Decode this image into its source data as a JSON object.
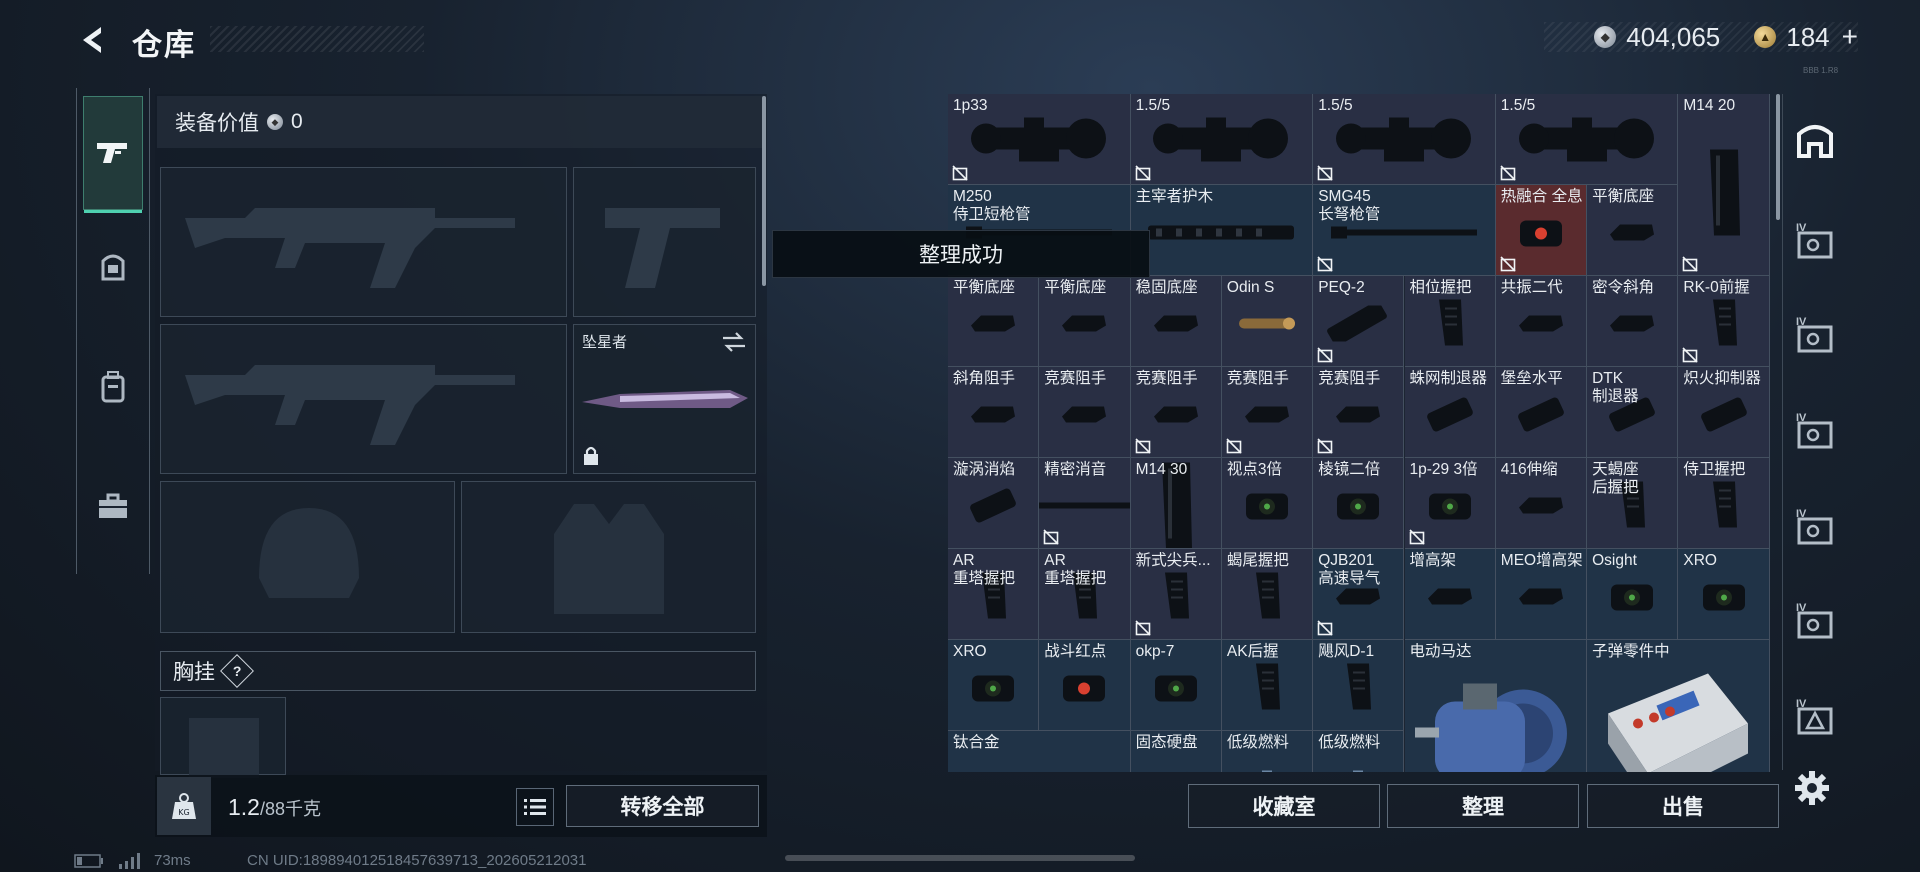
{
  "header": {
    "title": "仓库",
    "currency_silver": "404,065",
    "currency_gold": "184",
    "plus": "+",
    "build_tag": "BBB 1.R8"
  },
  "equipment": {
    "value_label": "装备价值",
    "value": "0",
    "melee_name": "坠星者",
    "chest_label": "胸挂",
    "chest_help": "?"
  },
  "footer_left": {
    "weight": "1.2",
    "weight_max": "/88千克",
    "weight_icon_text": "KG",
    "transfer_all": "转移全部"
  },
  "footer_right": {
    "collection": "收藏室",
    "organize": "整理",
    "sell": "出售"
  },
  "toast": "整理成功",
  "status": {
    "ping": "73ms",
    "uid": "CN UID:1898940125184576397​13_202605212031"
  },
  "inventory": [
    {
      "label": "1p33",
      "bg": "purple",
      "mark": true
    },
    {
      "label": "1.5/5",
      "bg": "purple",
      "mark": true
    },
    {
      "label": "1.5/5",
      "bg": "purple",
      "mark": true
    },
    {
      "label": "1.5/5",
      "bg": "purple",
      "mark": true
    },
    {
      "label": "M14 20",
      "bg": "purple",
      "mark": true
    },
    {
      "label": "M250\n侍卫短枪管",
      "bg": "blue",
      "mark": false
    },
    {
      "label": "主宰者护木",
      "bg": "blue",
      "mark": false
    },
    {
      "label": "SMG45\n长弩枪管",
      "bg": "blue",
      "mark": true
    },
    {
      "label": "热融合 全息",
      "bg": "red",
      "mark": true
    },
    {
      "label": "平衡底座",
      "bg": "purple",
      "mark": false
    },
    {
      "label": "平衡底座",
      "bg": "purple",
      "mark": false
    },
    {
      "label": "平衡底座",
      "bg": "purple",
      "mark": false
    },
    {
      "label": "稳固底座",
      "bg": "purple",
      "mark": false
    },
    {
      "label": "Odin S",
      "bg": "purple",
      "mark": false
    },
    {
      "label": "PEQ-2",
      "bg": "purple",
      "mark": true
    },
    {
      "label": "相位握把",
      "bg": "purple",
      "mark": false
    },
    {
      "label": "共振二代",
      "bg": "purple",
      "mark": false
    },
    {
      "label": "密令斜角",
      "bg": "purple",
      "mark": false
    },
    {
      "label": "RK-0前握",
      "bg": "purple",
      "mark": true
    },
    {
      "label": "斜角阻手",
      "bg": "purple",
      "mark": false
    },
    {
      "label": "竞赛阻手",
      "bg": "purple",
      "mark": false
    },
    {
      "label": "竞赛阻手",
      "bg": "purple",
      "mark": true
    },
    {
      "label": "竞赛阻手",
      "bg": "purple",
      "mark": true
    },
    {
      "label": "竞赛阻手",
      "bg": "purple",
      "mark": true
    },
    {
      "label": "蛛网制退器",
      "bg": "purple",
      "mark": false
    },
    {
      "label": "堡垒水平",
      "bg": "purple",
      "mark": false
    },
    {
      "label": "DTK\n制退器",
      "bg": "purple",
      "mark": false
    },
    {
      "label": "炽火抑制器",
      "bg": "purple",
      "mark": false
    },
    {
      "label": "漩涡消焰",
      "bg": "purple",
      "mark": false
    },
    {
      "label": "精密消音",
      "bg": "purple",
      "mark": true
    },
    {
      "label": "M14 30",
      "bg": "purple",
      "mark": false
    },
    {
      "label": "视点3倍",
      "bg": "purple",
      "mark": false
    },
    {
      "label": "棱镜二倍",
      "bg": "purple",
      "mark": false
    },
    {
      "label": "1p-29 3倍",
      "bg": "purple",
      "mark": true
    },
    {
      "label": "416伸缩",
      "bg": "purple",
      "mark": false
    },
    {
      "label": "天蝎座\n后握把",
      "bg": "purple",
      "mark": false
    },
    {
      "label": "侍卫握把",
      "bg": "purple",
      "mark": false
    },
    {
      "label": "AR\n重塔握把",
      "bg": "purple",
      "mark": false
    },
    {
      "label": "AR\n重塔握把",
      "bg": "purple",
      "mark": false
    },
    {
      "label": "新式尖兵...",
      "bg": "purple",
      "mark": true
    },
    {
      "label": "蝎尾握把",
      "bg": "purple",
      "mark": false
    },
    {
      "label": "QJB201\n高速导气",
      "bg": "blue",
      "mark": true
    },
    {
      "label": "增高架",
      "bg": "blue",
      "mark": false
    },
    {
      "label": "MEO增高架",
      "bg": "blue",
      "mark": false
    },
    {
      "label": "Osight",
      "bg": "blue",
      "mark": false
    },
    {
      "label": "XRO",
      "bg": "blue",
      "mark": false
    },
    {
      "label": "XRO",
      "bg": "blue",
      "mark": false
    },
    {
      "label": "战斗红点",
      "bg": "blue",
      "mark": false
    },
    {
      "label": "okp-7",
      "bg": "blue",
      "mark": false
    },
    {
      "label": "AK后握",
      "bg": "blue",
      "mark": false
    },
    {
      "label": "飓风D-1",
      "bg": "blue",
      "mark": false
    },
    {
      "label": "电动马达",
      "bg": "blue",
      "mark": false
    },
    {
      "label": "子弹零件中",
      "bg": "blue",
      "mark": false
    },
    {
      "label": "钛合金",
      "bg": "blue",
      "mark": false
    },
    {
      "label": "固态硬盘",
      "bg": "blue",
      "mark": false
    },
    {
      "label": "低级燃料",
      "bg": "blue",
      "mark": false
    },
    {
      "label": "低级燃料",
      "bg": "blue",
      "mark": false
    }
  ],
  "colors": {
    "accent": "#4fd1b0",
    "purple_cell": "#292f44",
    "blue_cell": "#203347",
    "red_cell": "#5a2b2e"
  }
}
